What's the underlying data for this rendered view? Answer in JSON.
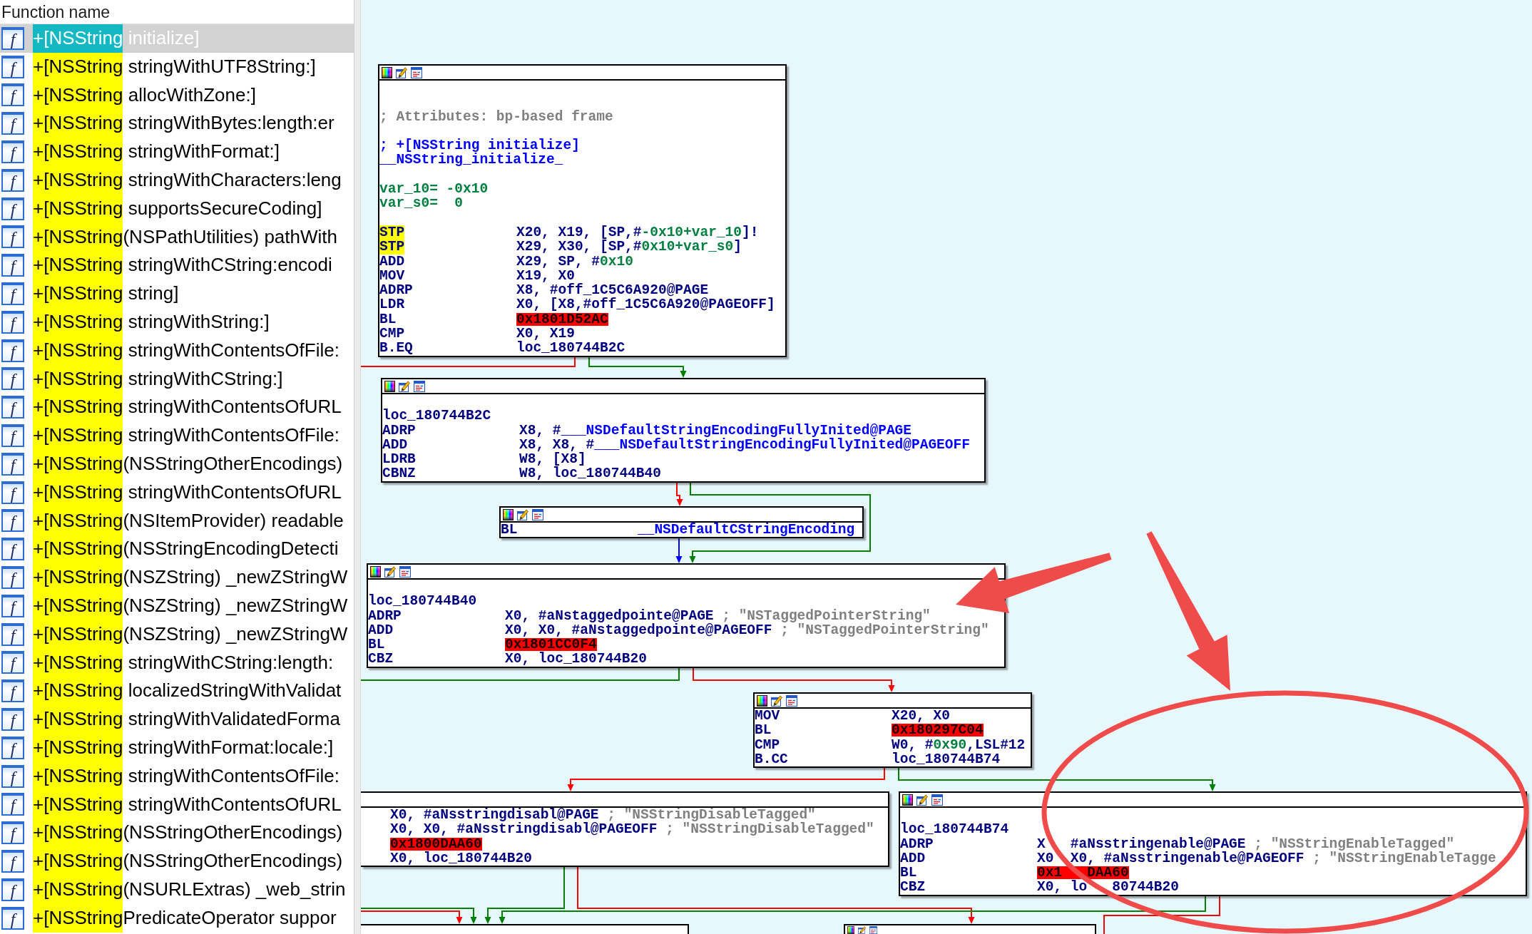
{
  "function_list": {
    "header": "Function name",
    "functions": [
      {
        "icon": "f",
        "match": "+[NSString",
        "rest": " initialize]",
        "selected": true
      },
      {
        "icon": "f",
        "match": "+[NSString",
        "rest": " stringWithUTF8String:]",
        "selected": false
      },
      {
        "icon": "f",
        "match": "+[NSString",
        "rest": " allocWithZone:]",
        "selected": false
      },
      {
        "icon": "f",
        "match": "+[NSString",
        "rest": " stringWithBytes:length:er",
        "selected": false
      },
      {
        "icon": "f",
        "match": "+[NSString",
        "rest": " stringWithFormat:]",
        "selected": false
      },
      {
        "icon": "f",
        "match": "+[NSString",
        "rest": " stringWithCharacters:leng",
        "selected": false
      },
      {
        "icon": "f",
        "match": "+[NSString",
        "rest": " supportsSecureCoding]",
        "selected": false
      },
      {
        "icon": "f",
        "match": "+[NSString",
        "rest": "(NSPathUtilities) pathWith",
        "selected": false
      },
      {
        "icon": "f",
        "match": "+[NSString",
        "rest": " stringWithCString:encodi",
        "selected": false
      },
      {
        "icon": "f",
        "match": "+[NSString",
        "rest": " string]",
        "selected": false
      },
      {
        "icon": "f",
        "match": "+[NSString",
        "rest": " stringWithString:]",
        "selected": false
      },
      {
        "icon": "f",
        "match": "+[NSString",
        "rest": " stringWithContentsOfFile:",
        "selected": false
      },
      {
        "icon": "f",
        "match": "+[NSString",
        "rest": " stringWithCString:]",
        "selected": false
      },
      {
        "icon": "f",
        "match": "+[NSString",
        "rest": " stringWithContentsOfURL",
        "selected": false
      },
      {
        "icon": "f",
        "match": "+[NSString",
        "rest": " stringWithContentsOfFile:",
        "selected": false
      },
      {
        "icon": "f",
        "match": "+[NSString",
        "rest": "(NSStringOtherEncodings)",
        "selected": false
      },
      {
        "icon": "f",
        "match": "+[NSString",
        "rest": " stringWithContentsOfURL",
        "selected": false
      },
      {
        "icon": "f",
        "match": "+[NSString",
        "rest": "(NSItemProvider) readable",
        "selected": false
      },
      {
        "icon": "f",
        "match": "+[NSString",
        "rest": "(NSStringEncodingDetecti",
        "selected": false
      },
      {
        "icon": "f",
        "match": "+[NSString",
        "rest": "(NSZString) _newZStringW",
        "selected": false
      },
      {
        "icon": "f",
        "match": "+[NSString",
        "rest": "(NSZString) _newZStringW",
        "selected": false
      },
      {
        "icon": "f",
        "match": "+[NSString",
        "rest": "(NSZString) _newZStringW",
        "selected": false
      },
      {
        "icon": "f",
        "match": "+[NSString",
        "rest": " stringWithCString:length:",
        "selected": false
      },
      {
        "icon": "f",
        "match": "+[NSString",
        "rest": " localizedStringWithValidat",
        "selected": false
      },
      {
        "icon": "f",
        "match": "+[NSString",
        "rest": " stringWithValidatedForma",
        "selected": false
      },
      {
        "icon": "f",
        "match": "+[NSString",
        "rest": " stringWithFormat:locale:]",
        "selected": false
      },
      {
        "icon": "f",
        "match": "+[NSString",
        "rest": " stringWithContentsOfFile:",
        "selected": false
      },
      {
        "icon": "f",
        "match": "+[NSString",
        "rest": " stringWithContentsOfURL",
        "selected": false
      },
      {
        "icon": "f",
        "match": "+[NSString",
        "rest": "(NSStringOtherEncodings)",
        "selected": false
      },
      {
        "icon": "f",
        "match": "+[NSString",
        "rest": "(NSStringOtherEncodings)",
        "selected": false
      },
      {
        "icon": "f",
        "match": "+[NSString",
        "rest": "(NSURLExtras) _web_strin",
        "selected": false
      },
      {
        "icon": "f",
        "match": "+[NSString",
        "rest": "PredicateOperator suppor",
        "selected": false
      }
    ]
  },
  "graph": {
    "nodes": [
      {
        "sections": [
          [
            {
              "kind": "plain",
              "segments": [
                {
                  "kind": "comment",
                  "text": "; Attributes: bp-based frame"
                }
              ]
            }
          ],
          [
            {
              "kind": "plain",
              "segments": [
                {
                  "kind": "symbol",
                  "text": "; +[NSString initialize]"
                }
              ]
            },
            {
              "kind": "plain",
              "segments": [
                {
                  "kind": "symbol",
                  "text": "__NSString_initialize_"
                }
              ]
            }
          ],
          [
            {
              "kind": "plain",
              "segments": [
                {
                  "kind": "number",
                  "text": "var_10= -0x10"
                }
              ]
            },
            {
              "kind": "plain",
              "segments": [
                {
                  "kind": "number",
                  "text": "var_s0=  0"
                }
              ]
            }
          ],
          [
            {
              "kind": "instr",
              "mnemonic": "STP",
              "highlighted": true,
              "operands": [
                {
                  "kind": "text",
                  "text": "X20, X19, [SP,#"
                },
                {
                  "kind": "number",
                  "text": "-0x10+var_10"
                },
                {
                  "kind": "text",
                  "text": "]!"
                }
              ]
            },
            {
              "kind": "instr",
              "mnemonic": "STP",
              "highlighted": true,
              "operands": [
                {
                  "kind": "text",
                  "text": "X29, X30, [SP,#"
                },
                {
                  "kind": "number",
                  "text": "0x10+var_s0"
                },
                {
                  "kind": "text",
                  "text": "]"
                }
              ]
            },
            {
              "kind": "instr",
              "mnemonic": "ADD",
              "highlighted": false,
              "operands": [
                {
                  "kind": "text",
                  "text": "X29, SP, #"
                },
                {
                  "kind": "number",
                  "text": "0x10"
                }
              ]
            },
            {
              "kind": "instr",
              "mnemonic": "MOV",
              "highlighted": false,
              "operands": [
                {
                  "kind": "text",
                  "text": "X19, X0"
                }
              ]
            },
            {
              "kind": "instr",
              "mnemonic": "ADRP",
              "highlighted": false,
              "operands": [
                {
                  "kind": "text",
                  "text": "X8, #off_1C5C6A920@PAGE"
                }
              ]
            },
            {
              "kind": "instr",
              "mnemonic": "LDR",
              "highlighted": false,
              "operands": [
                {
                  "kind": "text",
                  "text": "X0, [X8,#off_1C5C6A920@PAGEOFF]"
                }
              ]
            },
            {
              "kind": "instr",
              "mnemonic": "BL",
              "highlighted": false,
              "operands": [
                {
                  "kind": "unresolved",
                  "text": "0x1801D52AC"
                }
              ]
            },
            {
              "kind": "instr",
              "mnemonic": "CMP",
              "highlighted": false,
              "operands": [
                {
                  "kind": "text",
                  "text": "X0, X19"
                }
              ]
            },
            {
              "kind": "instr",
              "mnemonic": "B.EQ",
              "highlighted": false,
              "operands": [
                {
                  "kind": "text",
                  "text": "loc_180744B2C"
                }
              ]
            }
          ]
        ]
      },
      {
        "sections": [
          [
            {
              "kind": "plain",
              "segments": [
                {
                  "kind": "text",
                  "text": "loc_180744B2C"
                }
              ]
            },
            {
              "kind": "instr",
              "mnemonic": "ADRP",
              "highlighted": false,
              "operands": [
                {
                  "kind": "text",
                  "text": "X8, #"
                },
                {
                  "kind": "symbol",
                  "text": "___NSDefaultStringEncodingFullyInited@PAGE"
                }
              ]
            },
            {
              "kind": "instr",
              "mnemonic": "ADD",
              "highlighted": false,
              "operands": [
                {
                  "kind": "text",
                  "text": "X8, X8, #"
                },
                {
                  "kind": "symbol",
                  "text": "___NSDefaultStringEncodingFullyInited@PAGEOFF"
                }
              ]
            },
            {
              "kind": "instr",
              "mnemonic": "LDRB",
              "highlighted": false,
              "operands": [
                {
                  "kind": "text",
                  "text": "W8, [X8]"
                }
              ]
            },
            {
              "kind": "instr",
              "mnemonic": "CBNZ",
              "highlighted": false,
              "operands": [
                {
                  "kind": "text",
                  "text": "W8, loc_180744B40"
                }
              ]
            }
          ]
        ]
      },
      {
        "sections": [
          [
            {
              "kind": "instr",
              "mnemonic": "BL",
              "highlighted": false,
              "operands": [
                {
                  "kind": "symbol",
                  "text": "__NSDefaultCStringEncoding"
                }
              ]
            }
          ]
        ]
      },
      {
        "sections": [
          [
            {
              "kind": "plain",
              "segments": [
                {
                  "kind": "text",
                  "text": "loc_180744B40"
                }
              ]
            },
            {
              "kind": "instr",
              "mnemonic": "ADRP",
              "highlighted": false,
              "operands": [
                {
                  "kind": "text",
                  "text": "X0, #aNstaggedpointe@PAGE"
                },
                {
                  "kind": "comment",
                  "text": " ; \"NSTaggedPointerString\""
                }
              ]
            },
            {
              "kind": "instr",
              "mnemonic": "ADD",
              "highlighted": false,
              "operands": [
                {
                  "kind": "text",
                  "text": "X0, X0, #aNstaggedpointe@PAGEOFF"
                },
                {
                  "kind": "comment",
                  "text": " ; \"NSTaggedPointerString\""
                }
              ]
            },
            {
              "kind": "instr",
              "mnemonic": "BL",
              "highlighted": false,
              "operands": [
                {
                  "kind": "unresolved",
                  "text": "0x1801CC0F4"
                }
              ]
            },
            {
              "kind": "instr",
              "mnemonic": "CBZ",
              "highlighted": false,
              "operands": [
                {
                  "kind": "text",
                  "text": "X0, loc_180744B20"
                }
              ]
            }
          ]
        ]
      },
      {
        "sections": [
          [
            {
              "kind": "instr",
              "mnemonic": "MOV",
              "highlighted": false,
              "operands": [
                {
                  "kind": "text",
                  "text": "X20, X0"
                }
              ]
            },
            {
              "kind": "instr",
              "mnemonic": "BL",
              "highlighted": false,
              "operands": [
                {
                  "kind": "unresolved",
                  "text": "0x180297C04"
                }
              ]
            },
            {
              "kind": "instr",
              "mnemonic": "CMP",
              "highlighted": false,
              "operands": [
                {
                  "kind": "text",
                  "text": "W0, #"
                },
                {
                  "kind": "number",
                  "text": "0x90"
                },
                {
                  "kind": "text",
                  "text": ",LSL#12"
                }
              ]
            },
            {
              "kind": "instr",
              "mnemonic": "B.CC",
              "highlighted": false,
              "operands": [
                {
                  "kind": "text",
                  "text": "loc_180744B74"
                }
              ]
            }
          ]
        ]
      },
      {
        "sections": [
          [
            {
              "kind": "operands",
              "operands": [
                {
                  "kind": "text",
                  "text": "X0, #aNsstringdisabl@PAGE"
                },
                {
                  "kind": "comment",
                  "text": " ; \"NSStringDisableTagged\""
                }
              ]
            },
            {
              "kind": "operands",
              "operands": [
                {
                  "kind": "text",
                  "text": "X0, X0, #aNsstringdisabl@PAGEOFF"
                },
                {
                  "kind": "comment",
                  "text": " ; \"NSStringDisableTagged\""
                }
              ]
            },
            {
              "kind": "operands",
              "operands": [
                {
                  "kind": "unresolved",
                  "text": "0x1800DAA60"
                }
              ]
            },
            {
              "kind": "operands",
              "operands": [
                {
                  "kind": "text",
                  "text": "X0, loc_180744B20"
                }
              ]
            }
          ]
        ]
      },
      {
        "sections": [
          [
            {
              "kind": "plain",
              "segments": [
                {
                  "kind": "text",
                  "text": "loc_180744B74"
                }
              ]
            },
            {
              "kind": "instr",
              "mnemonic": "ADRP",
              "highlighted": false,
              "operands": [
                {
                  "kind": "text",
                  "text": "X"
                },
                {
                  "kind": "covered"
                },
                {
                  "kind": "covered"
                },
                {
                  "kind": "text",
                  "text": " #aNsstringenable@PAGE"
                },
                {
                  "kind": "comment",
                  "text": " ; \"NSStringEnableTagged\""
                }
              ]
            },
            {
              "kind": "instr",
              "mnemonic": "ADD",
              "highlighted": false,
              "operands": [
                {
                  "kind": "text",
                  "text": "X0"
                },
                {
                  "kind": "covered"
                },
                {
                  "kind": "text",
                  "text": " X0, #aNsstringenable@PAGEOFF"
                },
                {
                  "kind": "comment",
                  "text": " ; \"NSStringEnableTagge"
                }
              ]
            },
            {
              "kind": "instr",
              "mnemonic": "BL",
              "highlighted": false,
              "operands": [
                {
                  "kind": "unresolved",
                  "text": "0x1"
                },
                {
                  "kind": "covered"
                },
                {
                  "kind": "covered"
                },
                {
                  "kind": "covered"
                },
                {
                  "kind": "unresolved",
                  "text": "DAA60"
                }
              ]
            },
            {
              "kind": "instr",
              "mnemonic": "CBZ",
              "highlighted": false,
              "operands": [
                {
                  "kind": "text",
                  "text": "X0, lo"
                },
                {
                  "kind": "covered"
                },
                {
                  "kind": "covered"
                },
                {
                  "kind": "covered"
                },
                {
                  "kind": "text",
                  "text": "80744B20"
                }
              ]
            }
          ]
        ]
      }
    ],
    "edges": [
      {
        "kind": "no"
      },
      {
        "kind": "yes"
      },
      {
        "kind": "no"
      },
      {
        "kind": "yes"
      },
      {
        "kind": "always"
      },
      {
        "kind": "yes"
      },
      {
        "kind": "no"
      },
      {
        "kind": "no"
      },
      {
        "kind": "yes"
      },
      {
        "kind": "no"
      },
      {
        "kind": "yes"
      },
      {
        "kind": "yes"
      },
      {
        "kind": "no"
      },
      {
        "kind": "yes"
      },
      {
        "kind": "no"
      }
    ]
  },
  "annotations": [
    {
      "kind": "arrow"
    },
    {
      "kind": "arrow"
    },
    {
      "kind": "ellipse"
    }
  ]
}
